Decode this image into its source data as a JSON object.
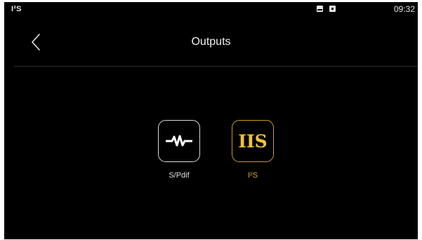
{
  "status_bar": {
    "left_label": "I²S",
    "time": "09:32",
    "icons": [
      "image-icon",
      "box-icon"
    ]
  },
  "header": {
    "title": "Outputs",
    "back_icon": "chevron-left-icon"
  },
  "outputs": [
    {
      "label": "S/Pdif",
      "icon": "waveform-icon",
      "selected": false
    },
    {
      "label": "I²S",
      "icon_text": "IIS",
      "selected": true
    }
  ],
  "colors": {
    "background": "#000000",
    "text": "#e6e6e6",
    "accent": "#f2c23a"
  }
}
